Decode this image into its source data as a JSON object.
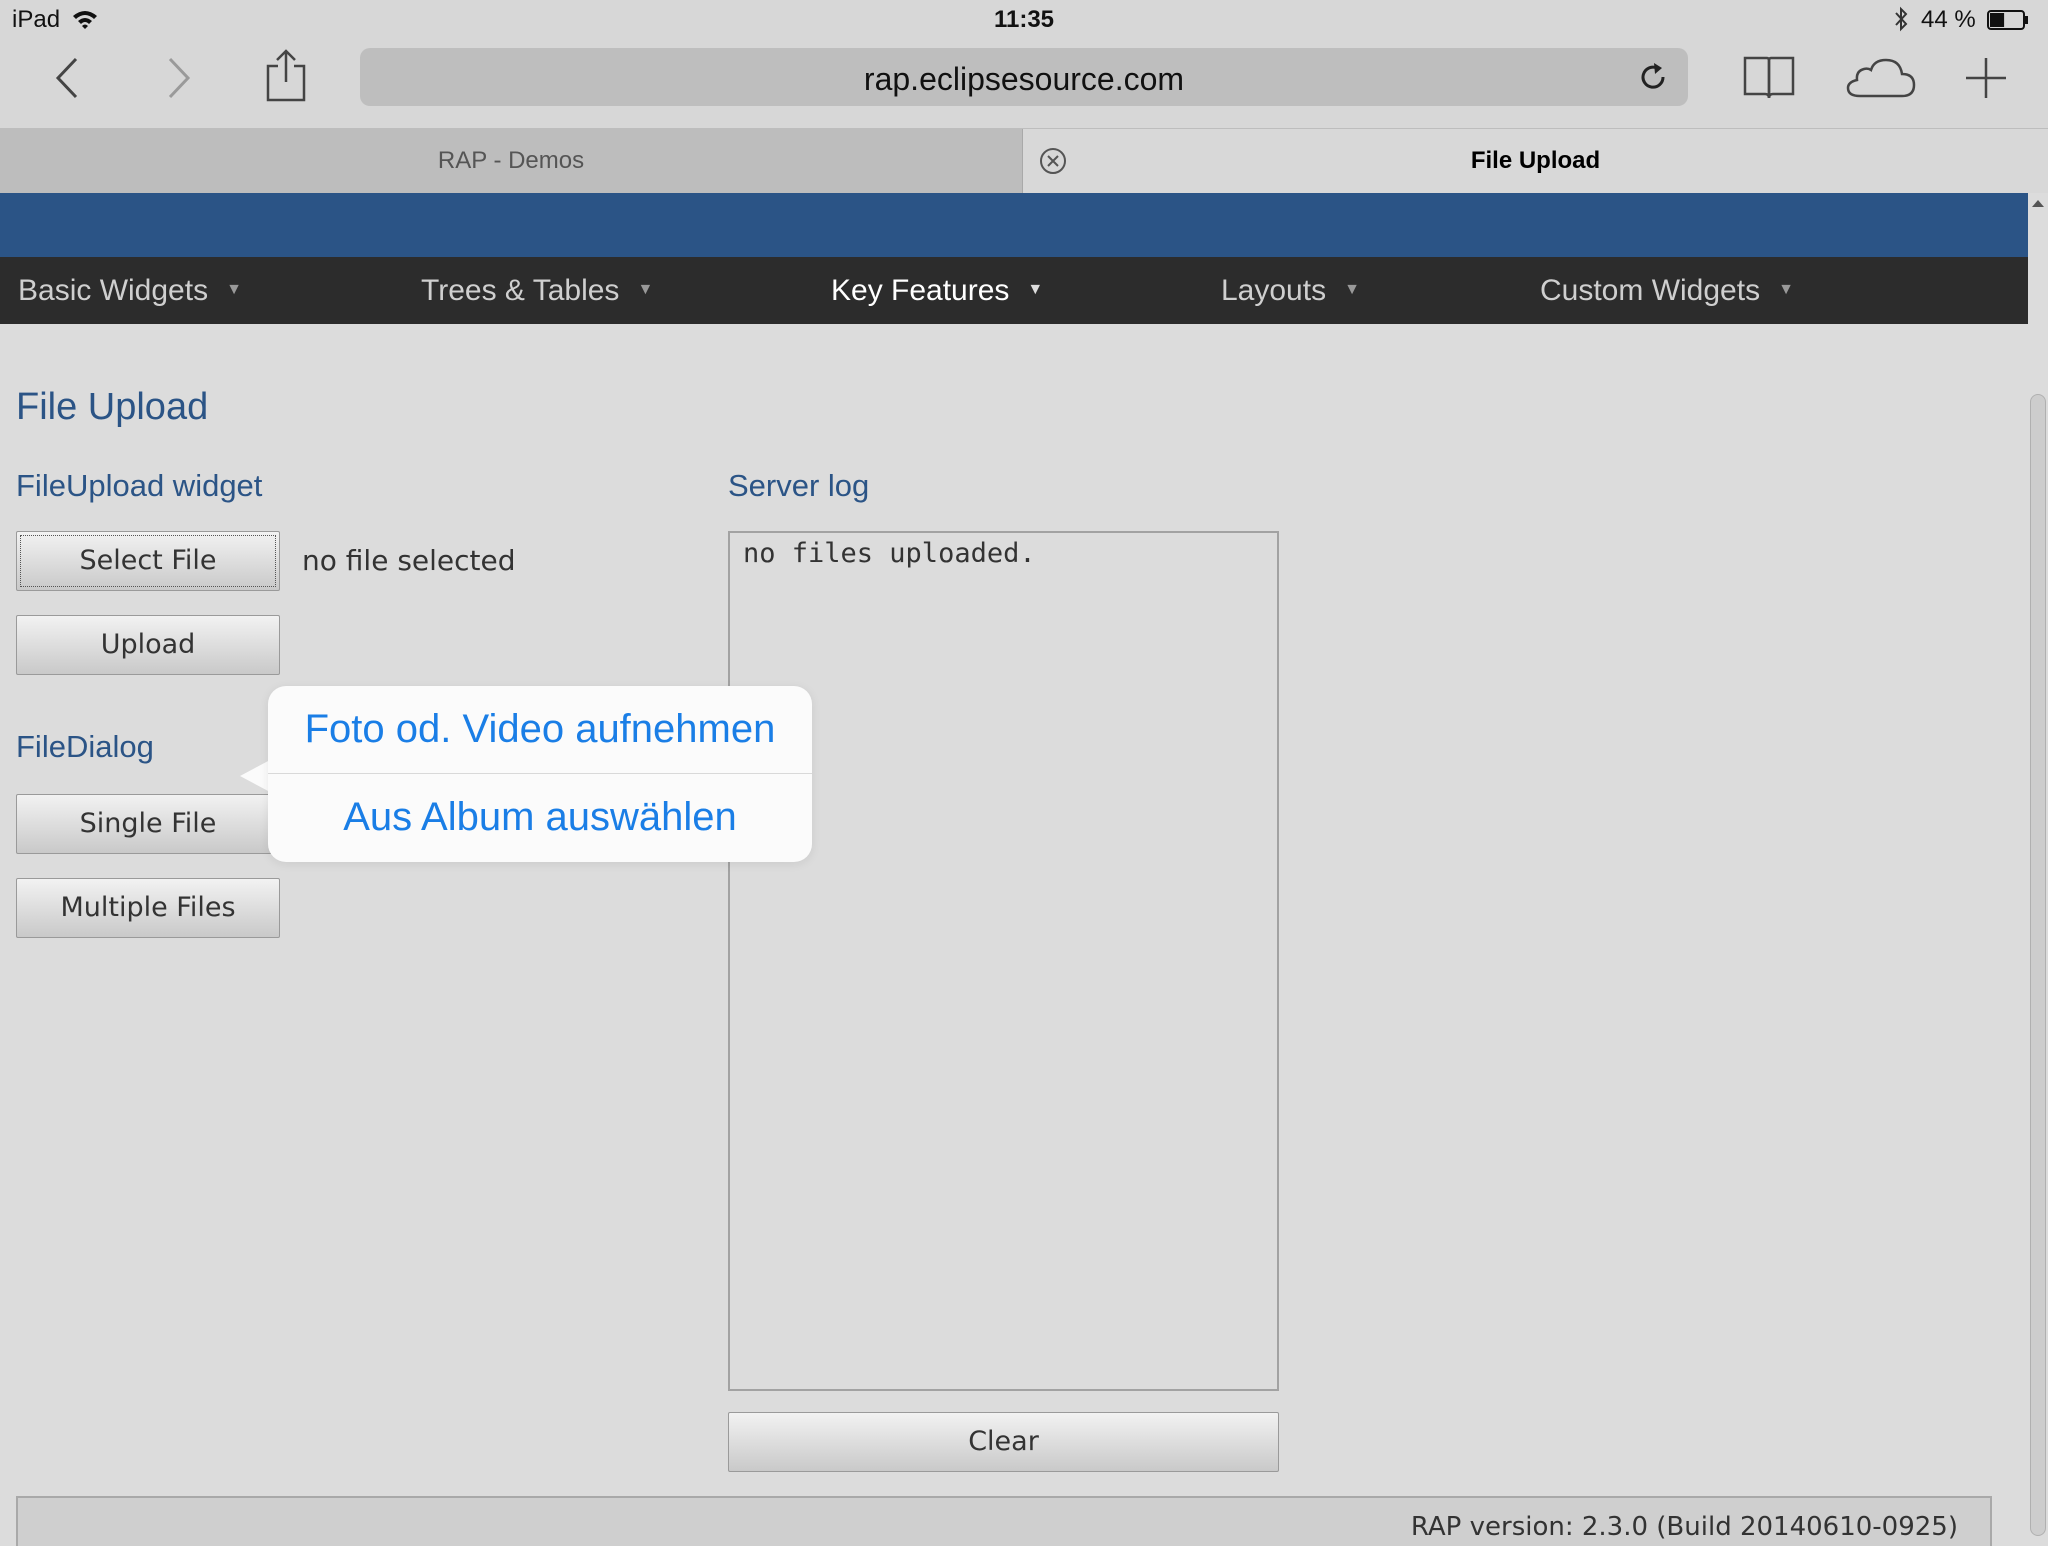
{
  "status_bar": {
    "device": "iPad",
    "time": "11:35",
    "battery_percent": "44 %",
    "battery_level": 0.44
  },
  "toolbar": {
    "url": "rap.eclipsesource.com"
  },
  "tabs": [
    {
      "label": "RAP - Demos"
    },
    {
      "label": "File Upload"
    }
  ],
  "nav": {
    "items": [
      {
        "label": "Basic Widgets"
      },
      {
        "label": "Trees & Tables"
      },
      {
        "label": "Key Features"
      },
      {
        "label": "Layouts"
      },
      {
        "label": "Custom Widgets"
      }
    ]
  },
  "main": {
    "title": "File Upload",
    "fileupload_heading": "FileUpload widget",
    "select_file_label": "Select File",
    "file_status": "no file selected",
    "upload_label": "Upload",
    "filedialog_heading": "FileDialog",
    "single_file_label": "Single File",
    "multiple_files_label": "Multiple Files",
    "server_log_heading": "Server log",
    "log_text": "no files uploaded.",
    "clear_label": "Clear",
    "version": "RAP version: 2.3.0 (Build 20140610-0925)"
  },
  "popover": {
    "items": [
      {
        "label": "Foto od. Video aufnehmen"
      },
      {
        "label": "Aus Album auswählen"
      }
    ]
  }
}
